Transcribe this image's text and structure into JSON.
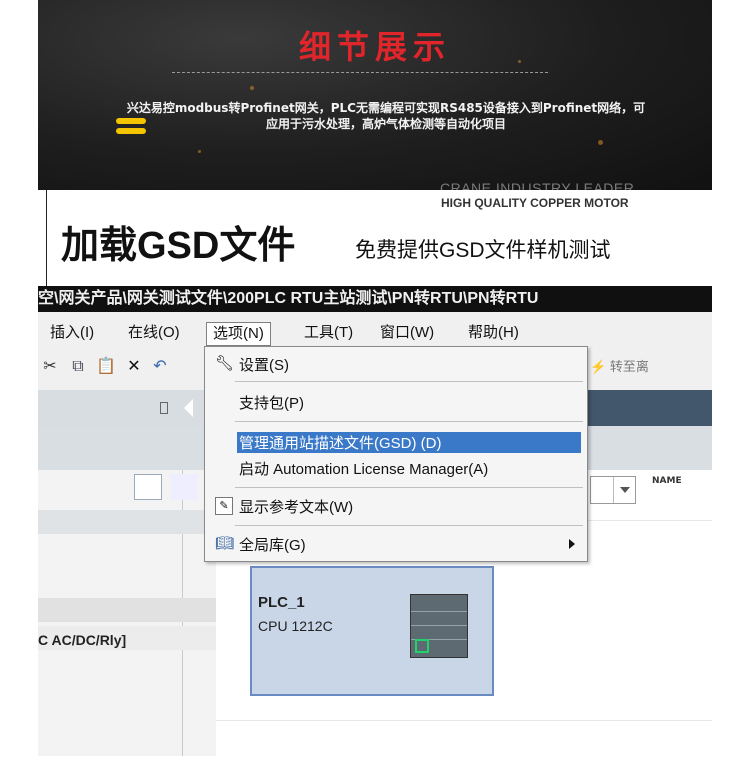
{
  "banner": {
    "title": "细节展示",
    "description": "兴达易控modbus转Profinet网关，PLC无需编程可实现RS485设备接入到Profinet网络，可应用于污水处理，高炉气体检测等自动化项目",
    "ghost_text": "CRANE INDUSTRY LEADER"
  },
  "strip": {
    "subtitle": "HIGH QUALITY COPPER MOTOR",
    "headline": "加载GSD文件",
    "note": "免费提供GSD文件样机测试"
  },
  "window": {
    "path": "空\\网关产品\\网关测试文件\\200PLC RTU主站测试\\PN转RTU\\PN转RTU",
    "menu": [
      "插入(I)",
      "在线(O)",
      "选项(N)",
      "工具(T)",
      "窗口(W)",
      "帮助(H)"
    ],
    "toolbar_right": "转至离",
    "left_label": "C AC/DC/Rly]",
    "plc": {
      "name": "PLC_1",
      "model": "CPU 1212C"
    },
    "name_icon": "NAME"
  },
  "dropdown": {
    "items": [
      {
        "label": "设置(S)",
        "icon": "wrench-icon"
      },
      {
        "label": "支持包(P)",
        "icon": ""
      },
      {
        "label": "管理通用站描述文件(GSD) (D)",
        "icon": "",
        "highlighted": true
      },
      {
        "label": "启动 Automation License Manager(A)",
        "icon": ""
      },
      {
        "label": "显示参考文本(W)",
        "icon": "text-reference-icon"
      },
      {
        "label": "全局库(G)",
        "icon": "book-icon"
      }
    ]
  },
  "colors": {
    "title_red": "#e0252b",
    "highlight_blue": "#3a78c8",
    "tab_dark": "#42576b"
  }
}
